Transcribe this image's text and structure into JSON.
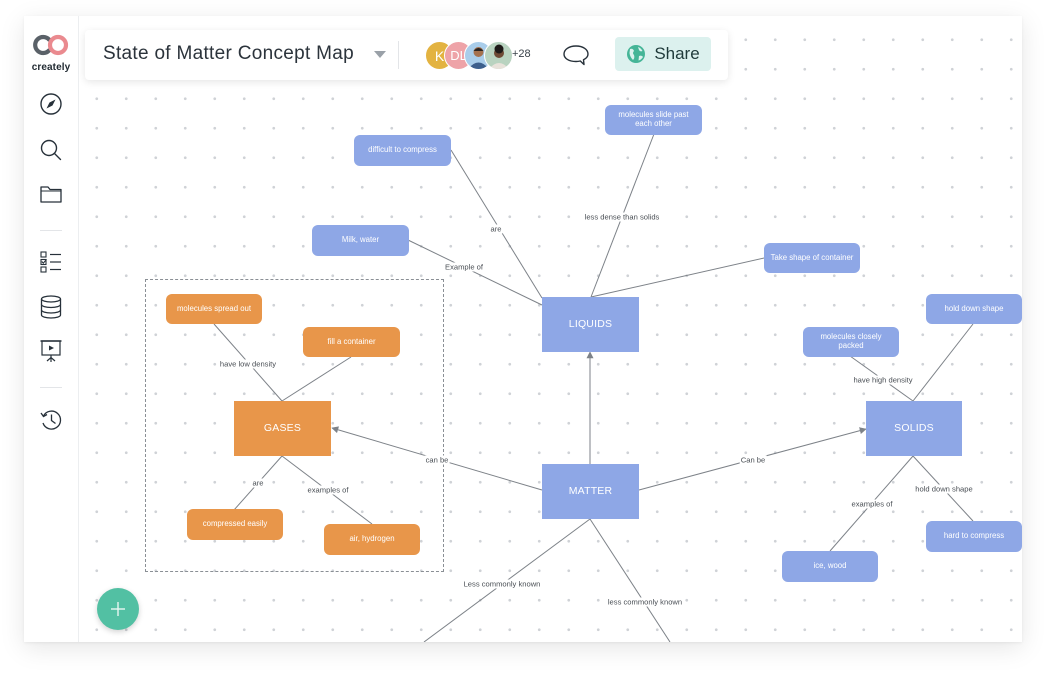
{
  "app": {
    "logo_text": "creately",
    "brand_colors": {
      "logo_gray": "#5a6168",
      "logo_pink": "#ea8a8f",
      "fab": "#52c0a3",
      "share_bg": "#dcf1ee"
    }
  },
  "sidebar": {
    "items": [
      {
        "id": "explore",
        "icon": "compass-icon"
      },
      {
        "id": "search",
        "icon": "search-icon"
      },
      {
        "id": "folder",
        "icon": "folder-icon"
      },
      {
        "id": "tasks",
        "icon": "checklist-icon"
      },
      {
        "id": "data",
        "icon": "database-icon"
      },
      {
        "id": "present",
        "icon": "presentation-icon"
      },
      {
        "id": "history",
        "icon": "history-icon"
      }
    ]
  },
  "toolbar": {
    "title": "State of Matter Concept Map",
    "title_dropdown_icon": "caret-down-icon",
    "collaborators": [
      {
        "initial": "K",
        "color": "#e3b341",
        "type": "initial"
      },
      {
        "initial": "DL",
        "color": "#eea3a8",
        "type": "initial"
      },
      {
        "initial": "",
        "color": "#a9cdea",
        "type": "photo"
      },
      {
        "initial": "",
        "color": "#b9d3c0",
        "type": "photo"
      }
    ],
    "more_collaborators": "+28",
    "comment_icon": "comment-icon",
    "share_label": "Share",
    "share_icon": "globe-icon"
  },
  "diagram": {
    "colors": {
      "blue": "#8ea7e6",
      "orange": "#e8964a",
      "edge": "#7d8288"
    },
    "nodes": {
      "matter": "MATTER",
      "liquids": "LIQUIDS",
      "gases": "GASES",
      "solids": "SOLIDS",
      "difficult_to_compress": "difficult to compress",
      "molecules_slide": "molecules slide past each other",
      "milk_water": "Milk, water",
      "take_shape": "Take shape of container",
      "hold_down_shape_top": "hold down shape",
      "molecules_closely": "molecules closely packed",
      "hard_to_compress": "hard to compress",
      "ice_wood": "ice, wood",
      "molecules_spread": "molecules spread out",
      "fill_container": "fill a container",
      "compressed_easily": "compressed easily",
      "air_hydrogen": "air, hydrogen"
    },
    "edge_labels": {
      "are_liquids": "are",
      "less_dense": "less dense than solids",
      "example_of": "Example of",
      "have_high_density": "have high density",
      "hold_down_shape": "hold down shape",
      "examples_of_solids": "examples of",
      "have_low_density": "have low density",
      "are_gases": "are",
      "examples_of_gases": "examples of",
      "can_be_gases": "can be",
      "can_be_solids": "Can be",
      "less_commonly_1": "Less commonly known",
      "less_commonly_2": "less commonly known"
    }
  },
  "fab": {
    "icon": "plus-icon"
  }
}
